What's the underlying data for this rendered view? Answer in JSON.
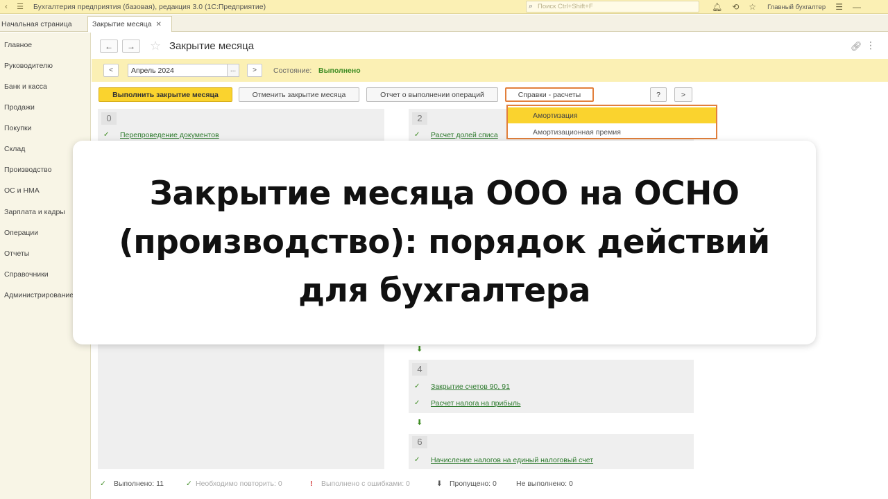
{
  "titlebar": {
    "app_title": "Бухгалтерия предприятия (базовая), редакция 3.0  (1С:Предприятие)",
    "search_placeholder": "Поиск Ctrl+Shift+F",
    "user": "Главный бухгалтер"
  },
  "tabs": {
    "home": "Начальная страница",
    "active": "Закрытие месяца"
  },
  "sidebar": {
    "items": [
      {
        "label": "Главное"
      },
      {
        "label": "Руководителю"
      },
      {
        "label": "Банк и касса"
      },
      {
        "label": "Продажи"
      },
      {
        "label": "Покупки"
      },
      {
        "label": "Склад"
      },
      {
        "label": "Производство"
      },
      {
        "label": "ОС и НМА"
      },
      {
        "label": "Зарплата и кадры"
      },
      {
        "label": "Операции"
      },
      {
        "label": "Отчеты"
      },
      {
        "label": "Справочники"
      },
      {
        "label": "Администрирование"
      }
    ]
  },
  "form": {
    "title": "Закрытие месяца",
    "period": "Апрель 2024",
    "state_label": "Состояние:",
    "state_value": "Выполнено",
    "prev_label": "<",
    "next_label": ">",
    "dots_label": "..."
  },
  "commands": {
    "run": "Выполнить закрытие месяца",
    "cancel": "Отменить закрытие месяца",
    "report": "Отчет о выполнении операций",
    "reference": "Справки - расчеты",
    "help": "?",
    "more": ">"
  },
  "menu": {
    "items": [
      "Амортизация",
      "Амортизационная премия"
    ]
  },
  "stages": {
    "s0": {
      "num": "0",
      "steps": [
        "Перепроведение документов"
      ]
    },
    "s2": {
      "num": "2",
      "steps": [
        "Расчет долей списа"
      ]
    },
    "s4": {
      "num": "4",
      "steps": [
        "Закрытие счетов 90, 91",
        "Расчет налога на прибыль"
      ]
    },
    "s6": {
      "num": "6",
      "steps": [
        "Начисление налогов на единый налоговый счет"
      ]
    }
  },
  "status": {
    "done": "Выполнено: 11",
    "repeat": "Необходимо повторить: 0",
    "errors": "Выполнено с ошибками: 0",
    "skipped": "Пропущено: 0",
    "not_done": "Не выполнено: 0"
  },
  "overlay": {
    "headline": "Закрытие месяца ООО на ОСНО (производство): порядок действий для бухгалтера"
  },
  "colors": {
    "accent_yellow": "#fad32e",
    "panel_yellow": "#fbf0b4",
    "success_green": "#3e8c23",
    "menu_outline": "#e27f3b"
  }
}
